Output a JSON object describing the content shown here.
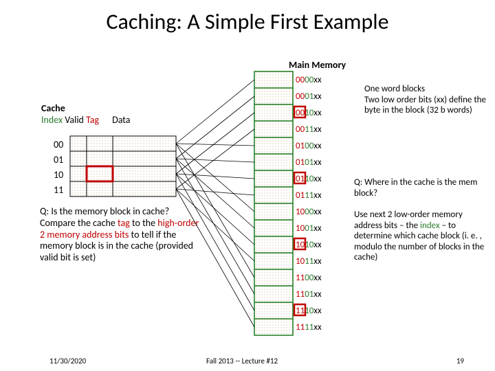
{
  "title": "Caching:  A Simple First Example",
  "mainmem_label": "Main Memory",
  "cache_header": {
    "cache": "Cache",
    "index": "Index",
    "valid": "Valid",
    "tag": "Tag",
    "data": "Data"
  },
  "cache_indices": [
    "00",
    "01",
    "10",
    "11"
  ],
  "memory_addresses": [
    "0000xx",
    "0001xx",
    "0010xx",
    "0011xx",
    "0100xx",
    "0101xx",
    "0110xx",
    "0111xx",
    "1000xx",
    "1001xx",
    "1010xx",
    "1011xx",
    "1100xx",
    "1101xx",
    "1110xx",
    "1111xx"
  ],
  "note_blocks": {
    "l1": "One word blocks",
    "l2": "Two low order bits (xx) define the byte in the block (32 b words)"
  },
  "q2": {
    "l1": "Q: Where in the cache is the mem block?",
    "l2_a": "Use next 2 low-order memory address bits – the ",
    "l2_b": "index",
    "l2_c": " – to determine which cache block (i. e. , modulo the number of blocks in the cache)"
  },
  "q1": {
    "l1": "Q: Is the memory block in cache?",
    "l2_a": "Compare the cache ",
    "l2_b": "tag",
    "l2_c": " to the ",
    "l2_d": "high-order 2 memory address bits",
    "l2_e": " to tell if the memory block is in the cache (provided valid bit is set)"
  },
  "footer": {
    "date": "11/30/2020",
    "center": "Fall 2013 -- Lecture #12",
    "page": "19"
  },
  "chart_data": {
    "type": "table",
    "cache": {
      "columns": [
        "Index",
        "Valid",
        "Tag",
        "Data"
      ],
      "rows": [
        {
          "index": "00",
          "valid": "",
          "tag": "",
          "data": ""
        },
        {
          "index": "01",
          "valid": "",
          "tag": "",
          "data": ""
        },
        {
          "index": "10",
          "valid": "",
          "tag": "",
          "data": ""
        },
        {
          "index": "11",
          "valid": "",
          "tag": "",
          "data": ""
        }
      ],
      "highlighted_tag_row": "10"
    },
    "main_memory": {
      "addresses": [
        "0000xx",
        "0001xx",
        "0010xx",
        "0011xx",
        "0100xx",
        "0101xx",
        "0110xx",
        "0111xx",
        "1000xx",
        "1001xx",
        "1010xx",
        "1011xx",
        "1100xx",
        "1101xx",
        "1110xx",
        "1111xx"
      ],
      "highlighted_tag_rows_ending_10": [
        "0010xx",
        "0110xx",
        "1010xx",
        "1110xx"
      ]
    },
    "mapping_lines": [
      {
        "from": "0000xx",
        "to": "00"
      },
      {
        "from": "0001xx",
        "to": "01"
      },
      {
        "from": "0010xx",
        "to": "10"
      },
      {
        "from": "0011xx",
        "to": "11"
      },
      {
        "from": "0100xx",
        "to": "00"
      },
      {
        "from": "0101xx",
        "to": "01"
      },
      {
        "from": "0110xx",
        "to": "10"
      },
      {
        "from": "0111xx",
        "to": "11"
      },
      {
        "from": "1000xx",
        "to": "00"
      },
      {
        "from": "1001xx",
        "to": "01"
      },
      {
        "from": "1010xx",
        "to": "10"
      },
      {
        "from": "1011xx",
        "to": "11"
      },
      {
        "from": "1100xx",
        "to": "00"
      },
      {
        "from": "1101xx",
        "to": "01"
      },
      {
        "from": "1110xx",
        "to": "10"
      },
      {
        "from": "1111xx",
        "to": "11"
      }
    ]
  }
}
